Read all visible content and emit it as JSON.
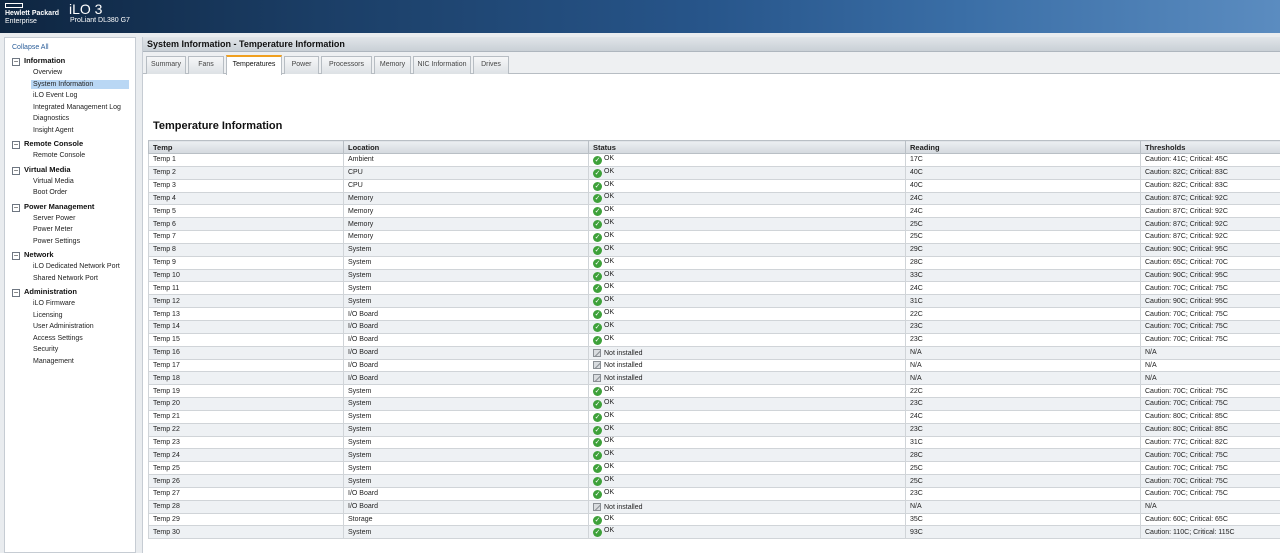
{
  "header": {
    "brand_line1": "Hewlett Packard",
    "brand_line2": "Enterprise",
    "product": "iLO 3",
    "model": "ProLiant DL380 G7"
  },
  "sidebar": {
    "collapse_all": "Collapse All",
    "toggle_symbol": "−",
    "sections": [
      {
        "label": "Information",
        "items": [
          "Overview",
          "System Information",
          "iLO Event Log",
          "Integrated Management Log",
          "Diagnostics",
          "Insight Agent"
        ],
        "selected": "System Information"
      },
      {
        "label": "Remote Console",
        "items": [
          "Remote Console"
        ]
      },
      {
        "label": "Virtual Media",
        "items": [
          "Virtual Media",
          "Boot Order"
        ]
      },
      {
        "label": "Power Management",
        "items": [
          "Server Power",
          "Power Meter",
          "Power Settings"
        ]
      },
      {
        "label": "Network",
        "items": [
          "iLO Dedicated Network Port",
          "Shared Network Port"
        ]
      },
      {
        "label": "Administration",
        "items": [
          "iLO Firmware",
          "Licensing",
          "User Administration",
          "Access Settings",
          "Security",
          "Management"
        ]
      }
    ]
  },
  "page": {
    "title": "System Information - Temperature Information",
    "section_title": "Temperature Information",
    "tabs": [
      "Summary",
      "Fans",
      "Temperatures",
      "Power",
      "Processors",
      "Memory",
      "NIC Information",
      "Drives"
    ],
    "active_tab": "Temperatures"
  },
  "table": {
    "columns": [
      "Temp",
      "Location",
      "Status",
      "Reading",
      "Thresholds"
    ],
    "rows": [
      [
        "Temp 1",
        "Ambient",
        "OK",
        "17C",
        "Caution: 41C; Critical: 45C"
      ],
      [
        "Temp 2",
        "CPU",
        "OK",
        "40C",
        "Caution: 82C; Critical: 83C"
      ],
      [
        "Temp 3",
        "CPU",
        "OK",
        "40C",
        "Caution: 82C; Critical: 83C"
      ],
      [
        "Temp 4",
        "Memory",
        "OK",
        "24C",
        "Caution: 87C; Critical: 92C"
      ],
      [
        "Temp 5",
        "Memory",
        "OK",
        "24C",
        "Caution: 87C; Critical: 92C"
      ],
      [
        "Temp 6",
        "Memory",
        "OK",
        "25C",
        "Caution: 87C; Critical: 92C"
      ],
      [
        "Temp 7",
        "Memory",
        "OK",
        "25C",
        "Caution: 87C; Critical: 92C"
      ],
      [
        "Temp 8",
        "System",
        "OK",
        "29C",
        "Caution: 90C; Critical: 95C"
      ],
      [
        "Temp 9",
        "System",
        "OK",
        "28C",
        "Caution: 65C; Critical: 70C"
      ],
      [
        "Temp 10",
        "System",
        "OK",
        "33C",
        "Caution: 90C; Critical: 95C"
      ],
      [
        "Temp 11",
        "System",
        "OK",
        "24C",
        "Caution: 70C; Critical: 75C"
      ],
      [
        "Temp 12",
        "System",
        "OK",
        "31C",
        "Caution: 90C; Critical: 95C"
      ],
      [
        "Temp 13",
        "I/O Board",
        "OK",
        "22C",
        "Caution: 70C; Critical: 75C"
      ],
      [
        "Temp 14",
        "I/O Board",
        "OK",
        "23C",
        "Caution: 70C; Critical: 75C"
      ],
      [
        "Temp 15",
        "I/O Board",
        "OK",
        "23C",
        "Caution: 70C; Critical: 75C"
      ],
      [
        "Temp 16",
        "I/O Board",
        "Not installed",
        "N/A",
        "N/A"
      ],
      [
        "Temp 17",
        "I/O Board",
        "Not installed",
        "N/A",
        "N/A"
      ],
      [
        "Temp 18",
        "I/O Board",
        "Not installed",
        "N/A",
        "N/A"
      ],
      [
        "Temp 19",
        "System",
        "OK",
        "22C",
        "Caution: 70C; Critical: 75C"
      ],
      [
        "Temp 20",
        "System",
        "OK",
        "23C",
        "Caution: 70C; Critical: 75C"
      ],
      [
        "Temp 21",
        "System",
        "OK",
        "24C",
        "Caution: 80C; Critical: 85C"
      ],
      [
        "Temp 22",
        "System",
        "OK",
        "23C",
        "Caution: 80C; Critical: 85C"
      ],
      [
        "Temp 23",
        "System",
        "OK",
        "31C",
        "Caution: 77C; Critical: 82C"
      ],
      [
        "Temp 24",
        "System",
        "OK",
        "28C",
        "Caution: 70C; Critical: 75C"
      ],
      [
        "Temp 25",
        "System",
        "OK",
        "25C",
        "Caution: 70C; Critical: 75C"
      ],
      [
        "Temp 26",
        "System",
        "OK",
        "25C",
        "Caution: 70C; Critical: 75C"
      ],
      [
        "Temp 27",
        "I/O Board",
        "OK",
        "23C",
        "Caution: 70C; Critical: 75C"
      ],
      [
        "Temp 28",
        "I/O Board",
        "Not installed",
        "N/A",
        "N/A"
      ],
      [
        "Temp 29",
        "Storage",
        "OK",
        "35C",
        "Caution: 60C; Critical: 65C"
      ],
      [
        "Temp 30",
        "System",
        "OK",
        "93C",
        "Caution: 110C; Critical: 115C"
      ]
    ]
  },
  "icons": {
    "ok": "check-circle-icon",
    "not_installed": "not-installed-icon",
    "ok_color": "#3ea13a"
  }
}
